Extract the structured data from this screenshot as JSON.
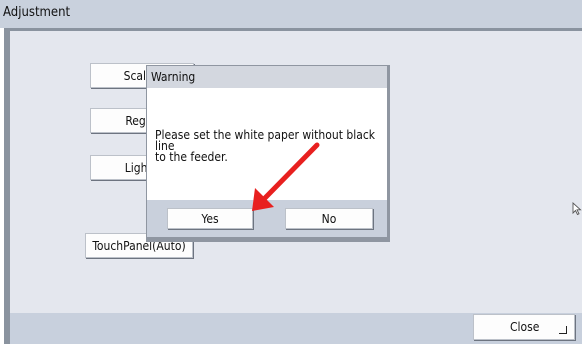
{
  "window": {
    "title": "Adjustment"
  },
  "buttons": {
    "scale": "Scale (",
    "regist": "Regist",
    "light": "Light (",
    "touch_panel": "TouchPanel(Auto)",
    "close": "Close"
  },
  "dialog": {
    "title": "Warning",
    "message_line1": "Please set the white paper without black line",
    "message_line2": "to the feeder.",
    "yes": "Yes",
    "no": "No"
  },
  "annotations": {
    "arrow_color": "#e8201f"
  },
  "icons": {
    "cursor": "mouse-pointer-icon",
    "close_corner": "corner-return-icon"
  }
}
